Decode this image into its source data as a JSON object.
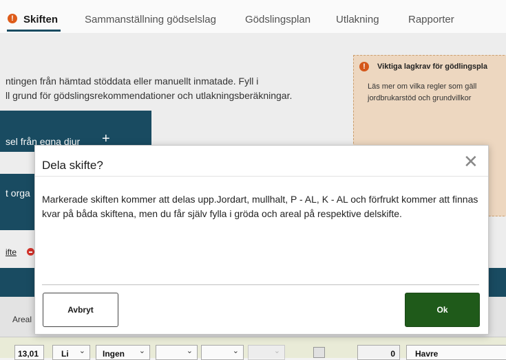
{
  "tabs": [
    {
      "label": "Skiften",
      "active": true
    },
    {
      "label": "Sammanställning gödselslag"
    },
    {
      "label": "Gödslingsplan"
    },
    {
      "label": "Utlakning"
    },
    {
      "label": "Rapporter"
    }
  ],
  "intro": {
    "line1": "ntingen från hämtad stöddata eller manuellt inmatade. Fyll i",
    "line2": "ll grund för gödslingsrekommendationer och utlakningsberäkningar."
  },
  "notice": {
    "title": "Viktiga lagkrav för gödlingspla",
    "body_line1": "Läs mer om vilka regler som gäll",
    "body_line2": "jordbrukarstöd och grundvillkor"
  },
  "cards": {
    "own_animals": "sel från egna djur",
    "plus": "+",
    "organic": "t orga"
  },
  "dela_link": "ifte",
  "table": {
    "areal_header": "Areal",
    "row": {
      "areal": "13,01",
      "jordart": "Li",
      "mullhalt": "Ingen",
      "value": "0",
      "crop": "Havre"
    }
  },
  "modal": {
    "title": "Dela skifte?",
    "close": "✕",
    "message": "Markerade skiften kommer att delas upp.Jordart, mullhalt, P - AL, K - AL och förfrukt kommer att finnas kvar på båda skiftena, men du får själv fylla i gröda och areal på respektive delskifte.",
    "cancel_label": "Avbryt",
    "ok_label": "Ok"
  },
  "colors": {
    "primary": "#1a4d63",
    "ok_green": "#1f5a1a",
    "notice_bg": "#f2dcc4",
    "warning": "#e35e1b"
  }
}
